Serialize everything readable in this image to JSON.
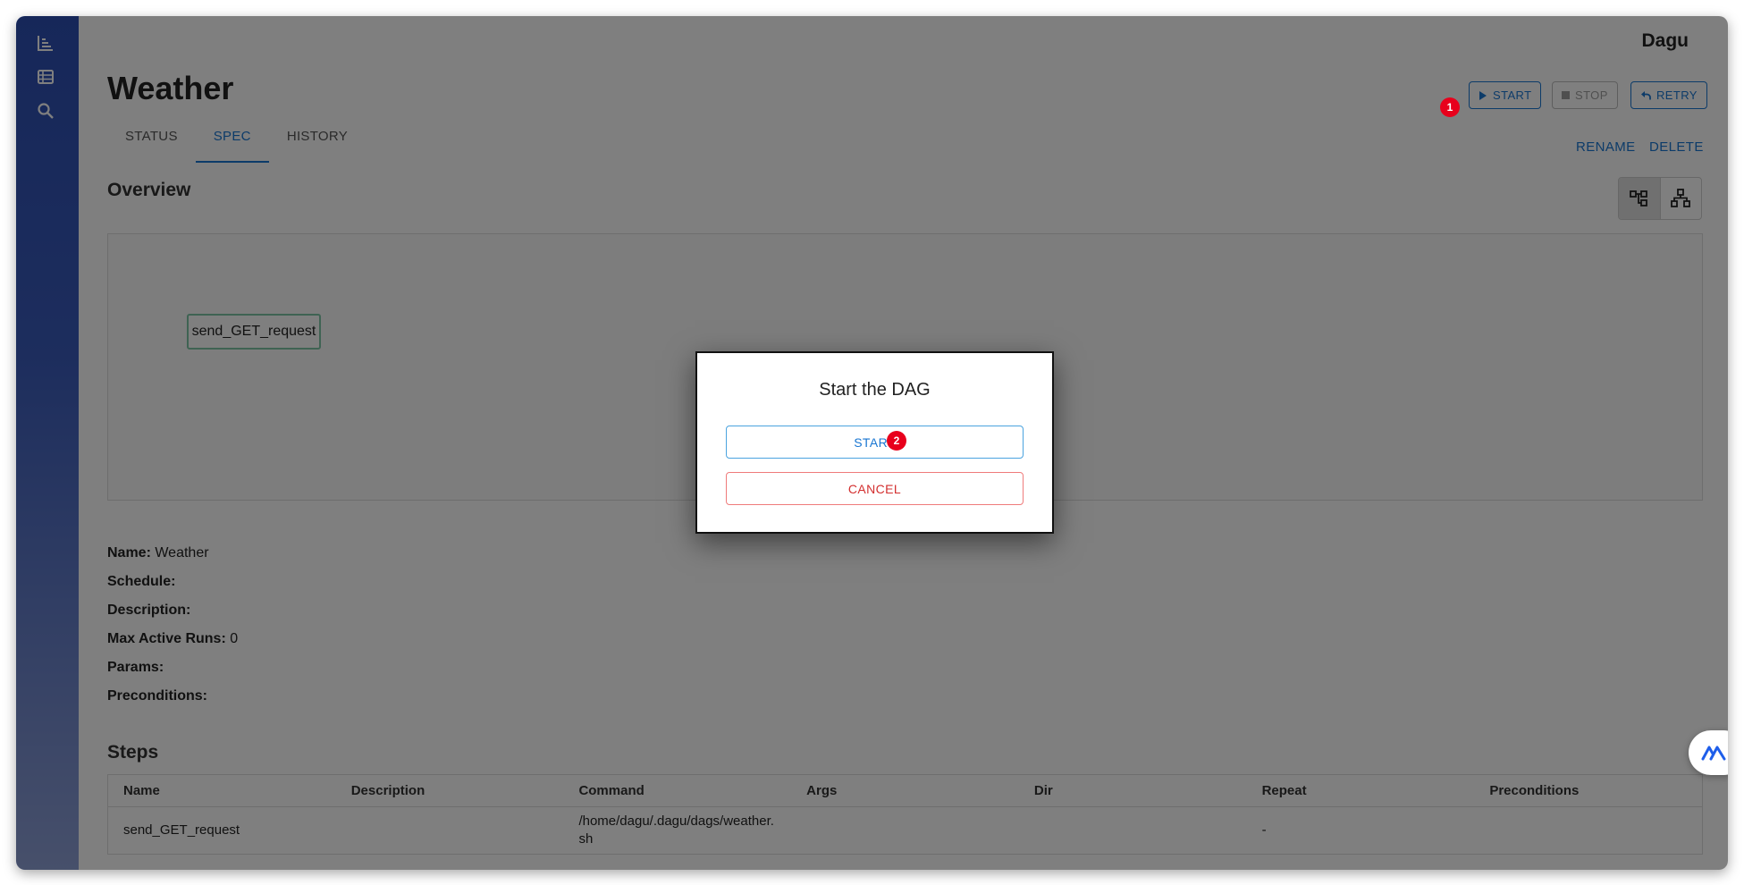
{
  "app": {
    "brand": "Dagu"
  },
  "sidebar": {
    "items": [
      {
        "icon": "chart-icon"
      },
      {
        "icon": "list-icon"
      },
      {
        "icon": "search-icon"
      }
    ]
  },
  "page": {
    "title": "Weather"
  },
  "tabs": [
    {
      "label": "STATUS",
      "active": false
    },
    {
      "label": "SPEC",
      "active": true
    },
    {
      "label": "HISTORY",
      "active": false
    }
  ],
  "actions": {
    "start_label": "START",
    "stop_label": "STOP",
    "retry_label": "RETRY",
    "rename_label": "RENAME",
    "delete_label": "DELETE"
  },
  "badges": {
    "first": "1",
    "second": "2"
  },
  "overview": {
    "title": "Overview",
    "node_label": "send_GET_request"
  },
  "details": [
    {
      "label": "Name:",
      "value": "Weather"
    },
    {
      "label": "Schedule:",
      "value": ""
    },
    {
      "label": "Description:",
      "value": ""
    },
    {
      "label": "Max Active Runs:",
      "value": "0"
    },
    {
      "label": "Params:",
      "value": ""
    },
    {
      "label": "Preconditions:",
      "value": ""
    }
  ],
  "steps": {
    "title": "Steps",
    "columns": [
      "Name",
      "Description",
      "Command",
      "Args",
      "Dir",
      "Repeat",
      "Preconditions"
    ],
    "rows": [
      [
        "send_GET_request",
        "",
        "/home/dagu/.dagu/dags/weather.sh",
        "",
        "",
        "-",
        ""
      ]
    ]
  },
  "dialog": {
    "title": "Start the DAG",
    "start_label": "START",
    "cancel_label": "CANCEL"
  },
  "colors": {
    "accent": "#1976d2",
    "danger": "#d32f2f",
    "badge": "#e8001c",
    "sidebar": "#2d4fb3"
  }
}
